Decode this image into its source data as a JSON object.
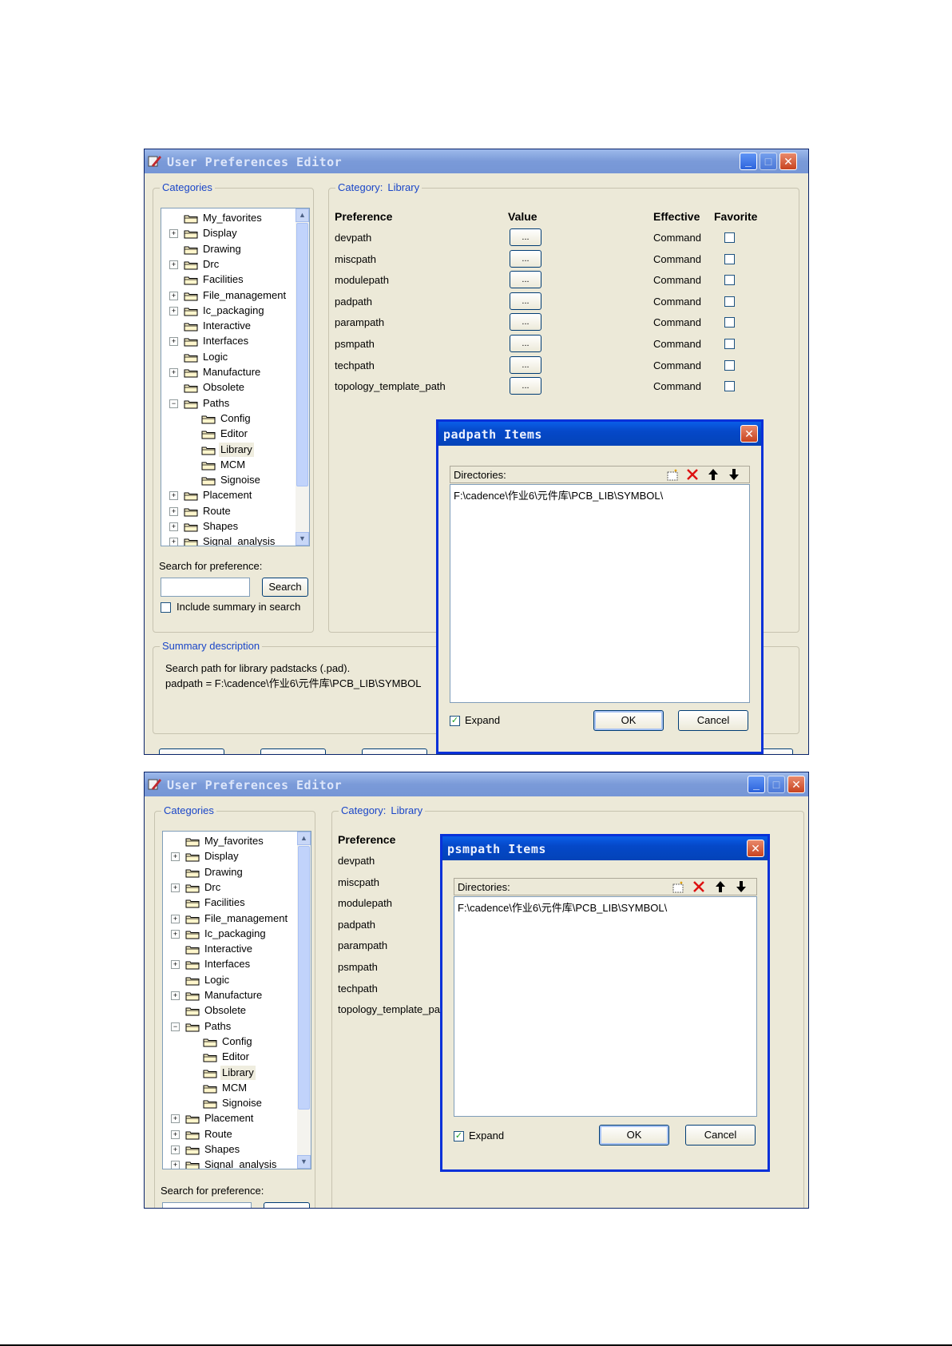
{
  "window_title": "User Preferences Editor",
  "categories_label": "Categories",
  "category_caption": "Category:",
  "category_value": "Library",
  "tree": [
    {
      "label": "My_favorites",
      "expander": "",
      "level": 0
    },
    {
      "label": "Display",
      "expander": "+",
      "level": 0
    },
    {
      "label": "Drawing",
      "expander": "",
      "level": 0
    },
    {
      "label": "Drc",
      "expander": "+",
      "level": 0
    },
    {
      "label": "Facilities",
      "expander": "",
      "level": 0
    },
    {
      "label": "File_management",
      "expander": "+",
      "level": 0
    },
    {
      "label": "Ic_packaging",
      "expander": "+",
      "level": 0
    },
    {
      "label": "Interactive",
      "expander": "",
      "level": 0
    },
    {
      "label": "Interfaces",
      "expander": "+",
      "level": 0
    },
    {
      "label": "Logic",
      "expander": "",
      "level": 0
    },
    {
      "label": "Manufacture",
      "expander": "+",
      "level": 0
    },
    {
      "label": "Obsolete",
      "expander": "",
      "level": 0
    },
    {
      "label": "Paths",
      "expander": "−",
      "level": 0
    },
    {
      "label": "Config",
      "expander": "",
      "level": 1
    },
    {
      "label": "Editor",
      "expander": "",
      "level": 1
    },
    {
      "label": "Library",
      "expander": "",
      "level": 1,
      "selected": true
    },
    {
      "label": "MCM",
      "expander": "",
      "level": 1
    },
    {
      "label": "Signoise",
      "expander": "",
      "level": 1
    },
    {
      "label": "Placement",
      "expander": "+",
      "level": 0
    },
    {
      "label": "Route",
      "expander": "+",
      "level": 0
    },
    {
      "label": "Shapes",
      "expander": "+",
      "level": 0
    },
    {
      "label": "Signal_analysis",
      "expander": "+",
      "level": 0
    }
  ],
  "columns": {
    "preference": "Preference",
    "value": "Value",
    "effective": "Effective",
    "favorite": "Favorite"
  },
  "preferences": [
    {
      "name": "devpath",
      "value_button": "...",
      "effective": "Command"
    },
    {
      "name": "miscpath",
      "value_button": "...",
      "effective": "Command"
    },
    {
      "name": "modulepath",
      "value_button": "...",
      "effective": "Command"
    },
    {
      "name": "padpath",
      "value_button": "...",
      "effective": "Command"
    },
    {
      "name": "parampath",
      "value_button": "...",
      "effective": "Command"
    },
    {
      "name": "psmpath",
      "value_button": "...",
      "effective": "Command"
    },
    {
      "name": "techpath",
      "value_button": "...",
      "effective": "Command"
    },
    {
      "name": "topology_template_path",
      "value_button": "...",
      "effective": "Command"
    }
  ],
  "search": {
    "label": "Search for preference:",
    "button": "Search",
    "include_summary": "Include summary in search"
  },
  "summary": {
    "label": "Summary description",
    "line1": "Search path for library padstacks (.pad).",
    "line2": "padpath = F:\\cadence\\作业6\\元件库\\PCB_LIB\\SYMBOL"
  },
  "dialog1": {
    "title": "padpath Items",
    "directories_label": "Directories:",
    "entry": "F:\\cadence\\作业6\\元件库\\PCB_LIB\\SYMBOL\\",
    "expand_label": "Expand",
    "ok": "OK",
    "cancel": "Cancel"
  },
  "dialog2": {
    "title": "psmpath Items",
    "directories_label": "Directories:",
    "entry": "F:\\cadence\\作业6\\元件库\\PCB_LIB\\SYMBOL\\",
    "expand_label": "Expand",
    "ok": "OK",
    "cancel": "Cancel"
  },
  "icons": {
    "new": "new-folder-icon",
    "delete": "delete-x-icon",
    "up": "arrow-up-icon",
    "down": "arrow-down-icon"
  },
  "colors": {
    "title_active": "#0548c8",
    "title_inactive": "#7a9ad8",
    "group_label": "#1a46c8",
    "dialog_border": "#0831d9",
    "window_bg": "#ece9d8"
  }
}
